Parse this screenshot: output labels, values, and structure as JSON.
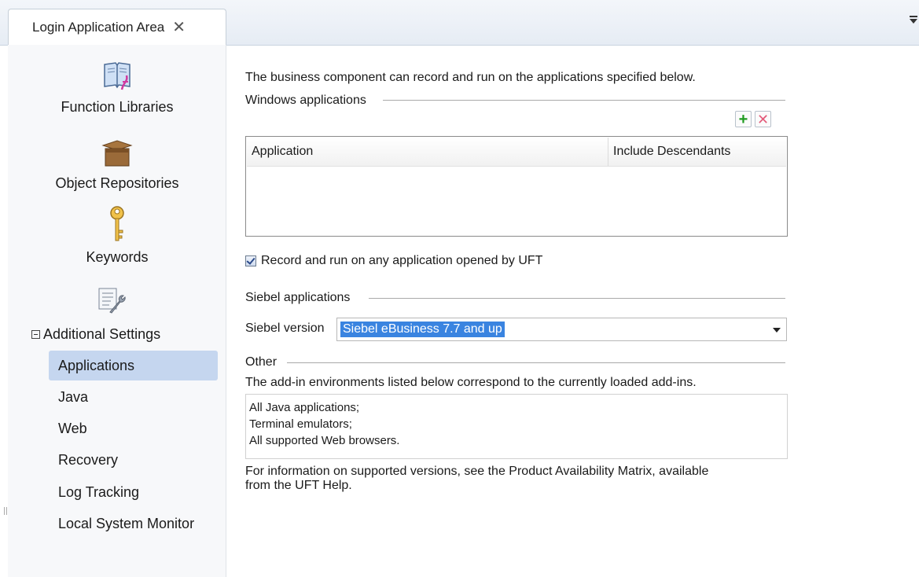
{
  "tab": {
    "title": "Login Application Area",
    "close": "✕"
  },
  "sidebar": {
    "categories": [
      {
        "label": "Function Libraries",
        "icon": "book-icon"
      },
      {
        "label": "Object Repositories",
        "icon": "box-icon"
      },
      {
        "label": "Keywords",
        "icon": "key-icon"
      }
    ],
    "settings_icon": "settings-wrench-icon",
    "settings_header": "Additional Settings",
    "items": [
      {
        "label": "Applications",
        "selected": true
      },
      {
        "label": "Java",
        "selected": false
      },
      {
        "label": "Web",
        "selected": false
      },
      {
        "label": "Recovery",
        "selected": false
      },
      {
        "label": "Log Tracking",
        "selected": false
      },
      {
        "label": "Local System Monitor",
        "selected": false
      }
    ]
  },
  "main": {
    "intro": "The business component can record and run on the applications specified below.",
    "windows": {
      "title": "Windows applications",
      "columns": [
        "Application",
        "Include Descendants"
      ],
      "rows": []
    },
    "record_any": {
      "label": "Record and run on any application opened by UFT",
      "checked": true
    },
    "siebel": {
      "title": "Siebel applications",
      "version_label": "Siebel version",
      "version_value": "Siebel eBusiness 7.7 and up"
    },
    "other": {
      "title": "Other",
      "description": "The add-in environments listed below correspond to the currently loaded add-ins.",
      "addins": [
        "All Java applications;",
        "Terminal emulators;",
        "All supported Web browsers."
      ],
      "info_line1": "For information on supported versions, see the Product Availability Matrix, available",
      "info_line2": "from the UFT Help."
    }
  },
  "colors": {
    "selection": "#3a84e0",
    "nav_selected": "#c5d6ef",
    "add": "#1f9b1f",
    "delete": "#e35b7a"
  }
}
